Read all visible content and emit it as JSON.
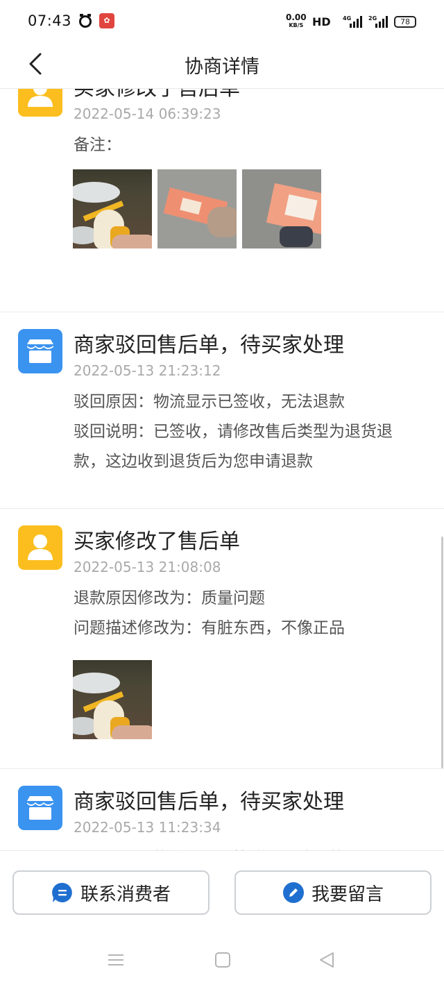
{
  "status_bar": {
    "time": "07:43",
    "net_speed_value": "0.00",
    "net_speed_unit": "KB/S",
    "hd_label": "HD",
    "sim1_label": "4G",
    "sim2_label": "2G",
    "battery": "78"
  },
  "header": {
    "title": "协商详情"
  },
  "entries": [
    {
      "type": "buyer",
      "title": "买家修改了售后单",
      "time": "2022-05-14 06:39:23",
      "lines": [
        "备注："
      ],
      "photos": [
        "food",
        "pack1",
        "pack2"
      ]
    },
    {
      "type": "shop",
      "title": "商家驳回售后单，待买家处理",
      "time": "2022-05-13 21:23:12",
      "lines": [
        "驳回原因：物流显示已签收，无法退款",
        "驳回说明：已签收，请修改售后类型为退货退",
        "款，这边收到退货后为您申请退款"
      ]
    },
    {
      "type": "buyer",
      "title": "买家修改了售后单",
      "time": "2022-05-13 21:08:08",
      "lines": [
        "退款原因修改为：质量问题",
        "问题描述修改为：有脏东西，不像正品"
      ],
      "photos": [
        "food"
      ]
    },
    {
      "type": "shop",
      "title": "商家驳回售后单，待买家处理",
      "time": "2022-05-13 11:23:34",
      "lines": [
        "驳回原因：物流显示已签收，无法退款"
      ]
    }
  ],
  "actions": {
    "contact_label": "联系消费者",
    "message_label": "我要留言"
  },
  "icons": {
    "buyer_avatar": "person-icon",
    "shop_avatar": "store-icon",
    "contact": "chat-bubble-icon",
    "message": "pencil-icon"
  },
  "colors": {
    "buyer_avatar_bg": "#fbbe1e",
    "shop_avatar_bg": "#3a93ef",
    "button_icon": "#1f6fd0",
    "timestamp": "#a9a9a9"
  }
}
